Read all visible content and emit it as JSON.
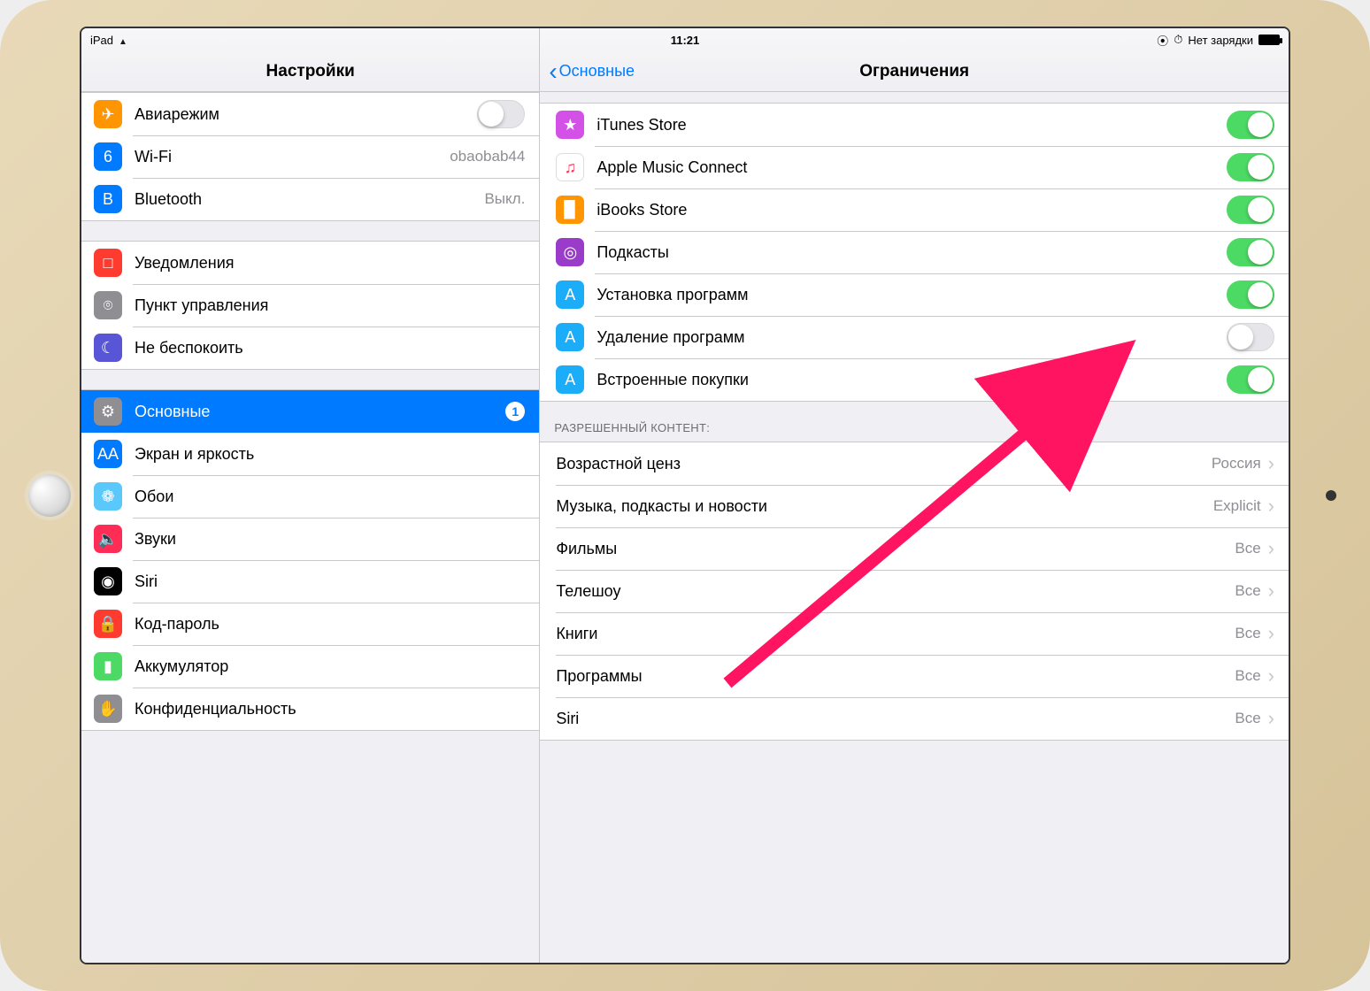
{
  "status": {
    "device": "iPad",
    "time": "11:21",
    "charging_text": "Нет зарядки",
    "orientation_lock": "⊕",
    "alarm": "⏰"
  },
  "left": {
    "title": "Настройки",
    "groups": [
      {
        "rows": [
          {
            "id": "airplane",
            "label": "Авиарежим",
            "toggle": false,
            "icon_bg": "#ff9500",
            "glyph": "✈"
          },
          {
            "id": "wifi",
            "label": "Wi-Fi",
            "value": "obaobab44",
            "chev": true,
            "icon_bg": "#007aff",
            "glyph": "὏6"
          },
          {
            "id": "bluetooth",
            "label": "Bluetooth",
            "value": "Выкл.",
            "chev": true,
            "icon_bg": "#007aff",
            "glyph": "B"
          }
        ]
      },
      {
        "rows": [
          {
            "id": "notifications",
            "label": "Уведомления",
            "chev": true,
            "icon_bg": "#ff3b30",
            "glyph": "□"
          },
          {
            "id": "control-center",
            "label": "Пункт управления",
            "chev": true,
            "icon_bg": "#8e8e93",
            "glyph": "⌾"
          },
          {
            "id": "dnd",
            "label": "Не беспокоить",
            "chev": true,
            "icon_bg": "#5856d6",
            "glyph": "☾"
          }
        ]
      },
      {
        "rows": [
          {
            "id": "general",
            "label": "Основные",
            "badge": "1",
            "selected": true,
            "icon_bg": "#8e8e93",
            "glyph": "⚙"
          },
          {
            "id": "display",
            "label": "Экран и яркость",
            "chev": true,
            "icon_bg": "#007aff",
            "glyph": "AA"
          },
          {
            "id": "wallpaper",
            "label": "Обои",
            "chev": true,
            "icon_bg": "#5ac8fa",
            "glyph": "❁"
          },
          {
            "id": "sounds",
            "label": "Звуки",
            "chev": true,
            "icon_bg": "#ff2d55",
            "glyph": "🔈"
          },
          {
            "id": "siri",
            "label": "Siri",
            "chev": true,
            "icon_bg": "#000",
            "glyph": "◉"
          },
          {
            "id": "passcode",
            "label": "Код-пароль",
            "chev": true,
            "icon_bg": "#ff3b30",
            "glyph": "🔒"
          },
          {
            "id": "battery",
            "label": "Аккумулятор",
            "chev": true,
            "icon_bg": "#4cd964",
            "glyph": "▮"
          },
          {
            "id": "privacy",
            "label": "Конфиденциальность",
            "chev": true,
            "icon_bg": "#8e8e93",
            "glyph": "✋"
          }
        ]
      }
    ]
  },
  "right": {
    "back": "Основные",
    "title": "Ограничения",
    "toggles": [
      {
        "id": "itunes",
        "label": "iTunes Store",
        "on": true,
        "icon_bg": "#d451e8",
        "glyph": "★"
      },
      {
        "id": "applemusic",
        "label": "Apple Music Connect",
        "on": true,
        "icon_bg": "#ffffff",
        "glyph": "♫",
        "border": true,
        "fg": "#ff2d55"
      },
      {
        "id": "ibooks",
        "label": "iBooks Store",
        "on": true,
        "icon_bg": "#ff9500",
        "glyph": "▉"
      },
      {
        "id": "podcasts",
        "label": "Подкасты",
        "on": true,
        "icon_bg": "#9a3cc9",
        "glyph": "◎"
      },
      {
        "id": "install",
        "label": "Установка программ",
        "on": true,
        "icon_bg": "#1badf8",
        "glyph": "A"
      },
      {
        "id": "delete",
        "label": "Удаление программ",
        "on": false,
        "icon_bg": "#1badf8",
        "glyph": "A"
      },
      {
        "id": "iap",
        "label": "Встроенные покупки",
        "on": true,
        "icon_bg": "#1badf8",
        "glyph": "A"
      }
    ],
    "content_header": "РАЗРЕШЕННЫЙ КОНТЕНТ:",
    "content_rows": [
      {
        "id": "ratings",
        "label": "Возрастной ценз",
        "value": "Россия"
      },
      {
        "id": "music",
        "label": "Музыка, подкасты и новости",
        "value": "Explicit"
      },
      {
        "id": "movies",
        "label": "Фильмы",
        "value": "Все"
      },
      {
        "id": "tv",
        "label": "Телешоу",
        "value": "Все"
      },
      {
        "id": "books",
        "label": "Книги",
        "value": "Все"
      },
      {
        "id": "apps",
        "label": "Программы",
        "value": "Все"
      },
      {
        "id": "siri",
        "label": "Siri",
        "value": "Все"
      }
    ]
  }
}
